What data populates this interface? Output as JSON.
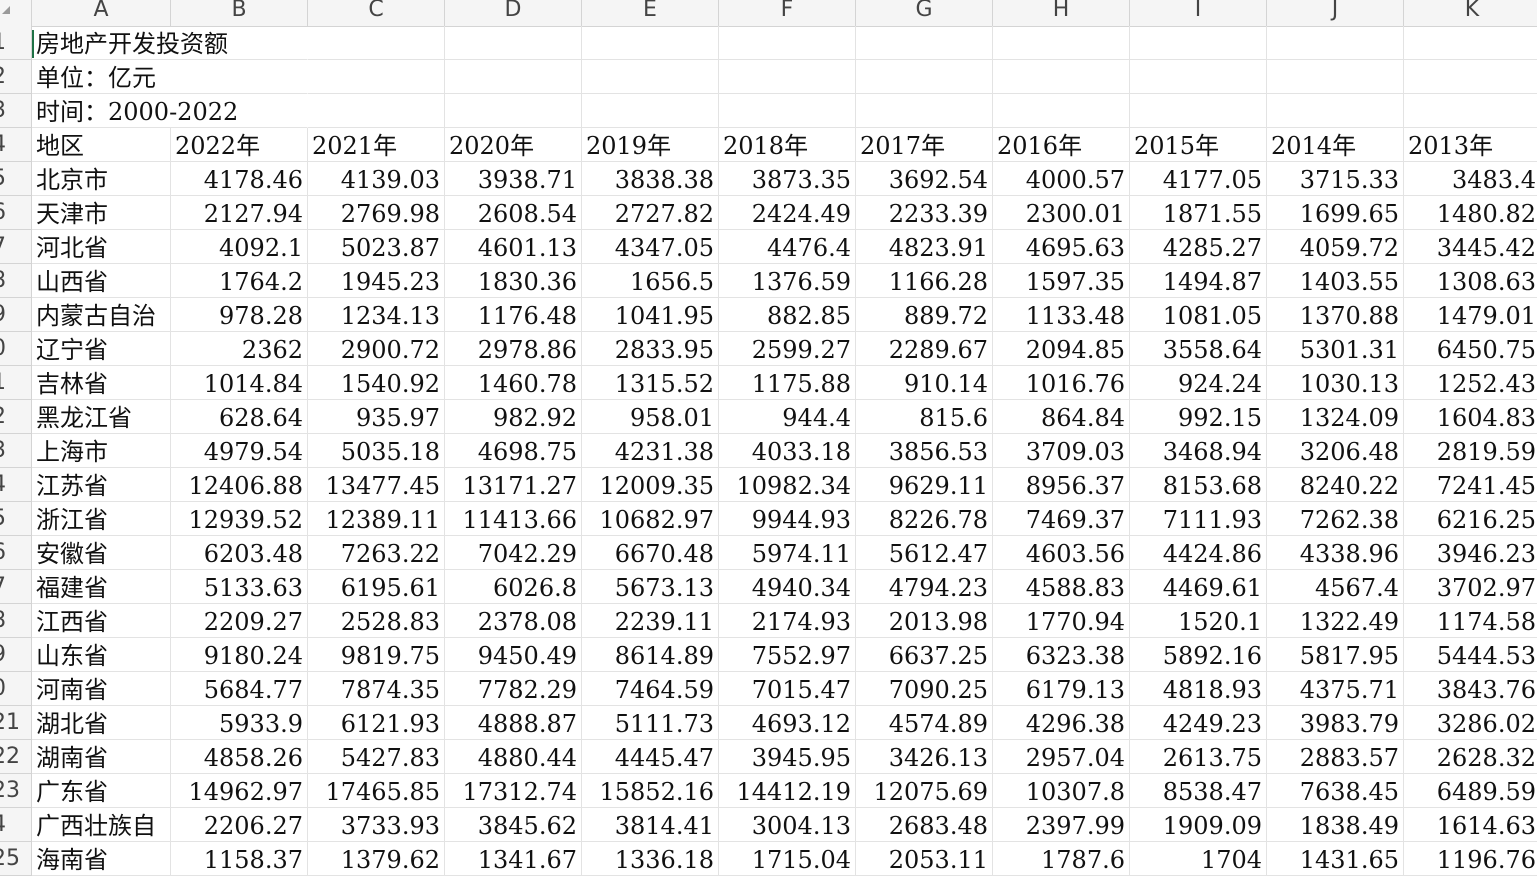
{
  "columns": [
    "A",
    "B",
    "C",
    "D",
    "E",
    "F",
    "G",
    "H",
    "I",
    "J",
    "K"
  ],
  "row_numbers": [
    "1",
    "2",
    "3",
    "4",
    "5",
    "6",
    "7",
    "8",
    "9",
    "0",
    "1",
    "2",
    "3",
    "4",
    "5",
    "6",
    "7",
    "8",
    "9",
    "0",
    "21",
    "22",
    "23",
    "4",
    "25"
  ],
  "title_rows": [
    "房地产开发投资额",
    "单位：亿元",
    "时间：2000-2022"
  ],
  "header": {
    "region_label": "地区",
    "years": [
      "2022年",
      "2021年",
      "2020年",
      "2019年",
      "2018年",
      "2017年",
      "2016年",
      "2015年",
      "2014年",
      "2013年"
    ]
  },
  "rows": [
    {
      "region": "北京市",
      "values": [
        "4178.46",
        "4139.03",
        "3938.71",
        "3838.38",
        "3873.35",
        "3692.54",
        "4000.57",
        "4177.05",
        "3715.33",
        "3483.4"
      ]
    },
    {
      "region": "天津市",
      "values": [
        "2127.94",
        "2769.98",
        "2608.54",
        "2727.82",
        "2424.49",
        "2233.39",
        "2300.01",
        "1871.55",
        "1699.65",
        "1480.82"
      ]
    },
    {
      "region": "河北省",
      "values": [
        "4092.1",
        "5023.87",
        "4601.13",
        "4347.05",
        "4476.4",
        "4823.91",
        "4695.63",
        "4285.27",
        "4059.72",
        "3445.42"
      ]
    },
    {
      "region": "山西省",
      "values": [
        "1764.2",
        "1945.23",
        "1830.36",
        "1656.5",
        "1376.59",
        "1166.28",
        "1597.35",
        "1494.87",
        "1403.55",
        "1308.63"
      ]
    },
    {
      "region": "内蒙古自治",
      "values": [
        "978.28",
        "1234.13",
        "1176.48",
        "1041.95",
        "882.85",
        "889.72",
        "1133.48",
        "1081.05",
        "1370.88",
        "1479.01"
      ]
    },
    {
      "region": "辽宁省",
      "values": [
        "2362",
        "2900.72",
        "2978.86",
        "2833.95",
        "2599.27",
        "2289.67",
        "2094.85",
        "3558.64",
        "5301.31",
        "6450.75"
      ]
    },
    {
      "region": "吉林省",
      "values": [
        "1014.84",
        "1540.92",
        "1460.78",
        "1315.52",
        "1175.88",
        "910.14",
        "1016.76",
        "924.24",
        "1030.13",
        "1252.43"
      ]
    },
    {
      "region": "黑龙江省",
      "values": [
        "628.64",
        "935.97",
        "982.92",
        "958.01",
        "944.4",
        "815.6",
        "864.84",
        "992.15",
        "1324.09",
        "1604.83"
      ]
    },
    {
      "region": "上海市",
      "values": [
        "4979.54",
        "5035.18",
        "4698.75",
        "4231.38",
        "4033.18",
        "3856.53",
        "3709.03",
        "3468.94",
        "3206.48",
        "2819.59"
      ]
    },
    {
      "region": "江苏省",
      "values": [
        "12406.88",
        "13477.45",
        "13171.27",
        "12009.35",
        "10982.34",
        "9629.11",
        "8956.37",
        "8153.68",
        "8240.22",
        "7241.45"
      ]
    },
    {
      "region": "浙江省",
      "values": [
        "12939.52",
        "12389.11",
        "11413.66",
        "10682.97",
        "9944.93",
        "8226.78",
        "7469.37",
        "7111.93",
        "7262.38",
        "6216.25"
      ]
    },
    {
      "region": "安徽省",
      "values": [
        "6203.48",
        "7263.22",
        "7042.29",
        "6670.48",
        "5974.11",
        "5612.47",
        "4603.56",
        "4424.86",
        "4338.96",
        "3946.23"
      ]
    },
    {
      "region": "福建省",
      "values": [
        "5133.63",
        "6195.61",
        "6026.8",
        "5673.13",
        "4940.34",
        "4794.23",
        "4588.83",
        "4469.61",
        "4567.4",
        "3702.97"
      ]
    },
    {
      "region": "江西省",
      "values": [
        "2209.27",
        "2528.83",
        "2378.08",
        "2239.11",
        "2174.93",
        "2013.98",
        "1770.94",
        "1520.1",
        "1322.49",
        "1174.58"
      ]
    },
    {
      "region": "山东省",
      "values": [
        "9180.24",
        "9819.75",
        "9450.49",
        "8614.89",
        "7552.97",
        "6637.25",
        "6323.38",
        "5892.16",
        "5817.95",
        "5444.53"
      ]
    },
    {
      "region": "河南省",
      "values": [
        "5684.77",
        "7874.35",
        "7782.29",
        "7464.59",
        "7015.47",
        "7090.25",
        "6179.13",
        "4818.93",
        "4375.71",
        "3843.76"
      ]
    },
    {
      "region": "湖北省",
      "values": [
        "5933.9",
        "6121.93",
        "4888.87",
        "5111.73",
        "4693.12",
        "4574.89",
        "4296.38",
        "4249.23",
        "3983.79",
        "3286.02"
      ]
    },
    {
      "region": "湖南省",
      "values": [
        "4858.26",
        "5427.83",
        "4880.44",
        "4445.47",
        "3945.95",
        "3426.13",
        "2957.04",
        "2613.75",
        "2883.57",
        "2628.32"
      ]
    },
    {
      "region": "广东省",
      "values": [
        "14962.97",
        "17465.85",
        "17312.74",
        "15852.16",
        "14412.19",
        "12075.69",
        "10307.8",
        "8538.47",
        "7638.45",
        "6489.59"
      ]
    },
    {
      "region": "广西壮族自",
      "values": [
        "2206.27",
        "3733.93",
        "3845.62",
        "3814.41",
        "3004.13",
        "2683.48",
        "2397.99",
        "1909.09",
        "1838.49",
        "1614.63"
      ]
    },
    {
      "region": "海南省",
      "values": [
        "1158.37",
        "1379.62",
        "1341.67",
        "1336.18",
        "1715.04",
        "2053.11",
        "1787.6",
        "1704",
        "1431.65",
        "1196.76"
      ]
    }
  ]
}
